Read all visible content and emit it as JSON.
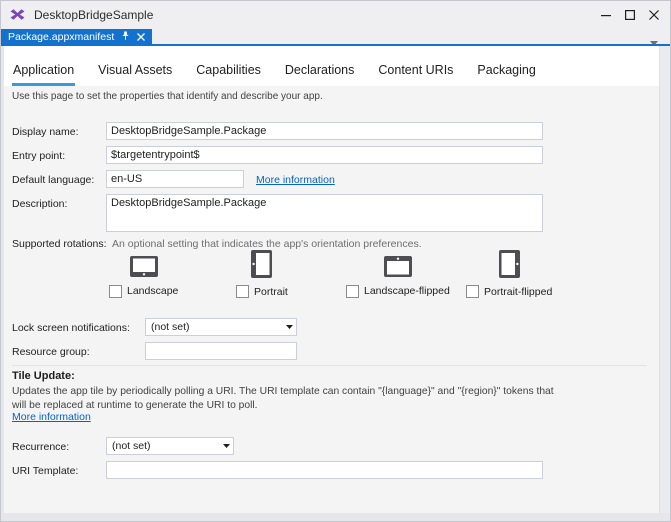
{
  "window": {
    "title": "DesktopBridgeSample",
    "controls": {
      "minimize": "minimize",
      "maximize": "maximize",
      "close": "close"
    }
  },
  "doc_tab": {
    "label": "Package.appxmanifest"
  },
  "nav_tabs": [
    {
      "label": "Application",
      "active": true
    },
    {
      "label": "Visual Assets",
      "active": false
    },
    {
      "label": "Capabilities",
      "active": false
    },
    {
      "label": "Declarations",
      "active": false
    },
    {
      "label": "Content URIs",
      "active": false
    },
    {
      "label": "Packaging",
      "active": false
    }
  ],
  "intro": "Use this page to set the properties that identify and describe your app.",
  "fields": {
    "display_name": {
      "label": "Display name:",
      "value": "DesktopBridgeSample.Package"
    },
    "entry_point": {
      "label": "Entry point:",
      "value": "$targetentrypoint$"
    },
    "default_language": {
      "label": "Default language:",
      "value": "en-US",
      "link": "More information"
    },
    "description": {
      "label": "Description:",
      "value": "DesktopBridgeSample.Package"
    },
    "supported_rotations": {
      "label": "Supported rotations:",
      "hint": "An optional setting that indicates the app's orientation preferences.",
      "options": [
        {
          "label": "Landscape",
          "checked": false
        },
        {
          "label": "Portrait",
          "checked": false
        },
        {
          "label": "Landscape-flipped",
          "checked": false
        },
        {
          "label": "Portrait-flipped",
          "checked": false
        }
      ]
    },
    "lock_screen_notifications": {
      "label": "Lock screen notifications:",
      "value": "(not set)"
    },
    "resource_group": {
      "label": "Resource group:",
      "value": ""
    },
    "recurrence": {
      "label": "Recurrence:",
      "value": "(not set)"
    },
    "uri_template": {
      "label": "URI Template:",
      "value": ""
    }
  },
  "tile_update": {
    "heading": "Tile Update:",
    "description": "Updates the app tile by periodically polling a URI. The URI template can contain \"{language}\" and \"{region}\" tokens that will be replaced at runtime to generate the URI to poll.",
    "link": "More information"
  },
  "icons": [
    "vs-logo-icon",
    "minimize-icon",
    "maximize-icon",
    "close-icon",
    "pin-icon",
    "tab-close-icon",
    "tab-list-dropdown-icon",
    "combo-arrow-icon",
    "landscape-icon",
    "portrait-icon",
    "landscape-flipped-icon",
    "portrait-flipped-icon"
  ],
  "colors": {
    "accent": "#1472CE",
    "tab_underline": "#3A99D9",
    "link": "#0663C5",
    "vs_logo_purple": "#7B45B8",
    "device_icon_gray": "#4D4D52"
  }
}
